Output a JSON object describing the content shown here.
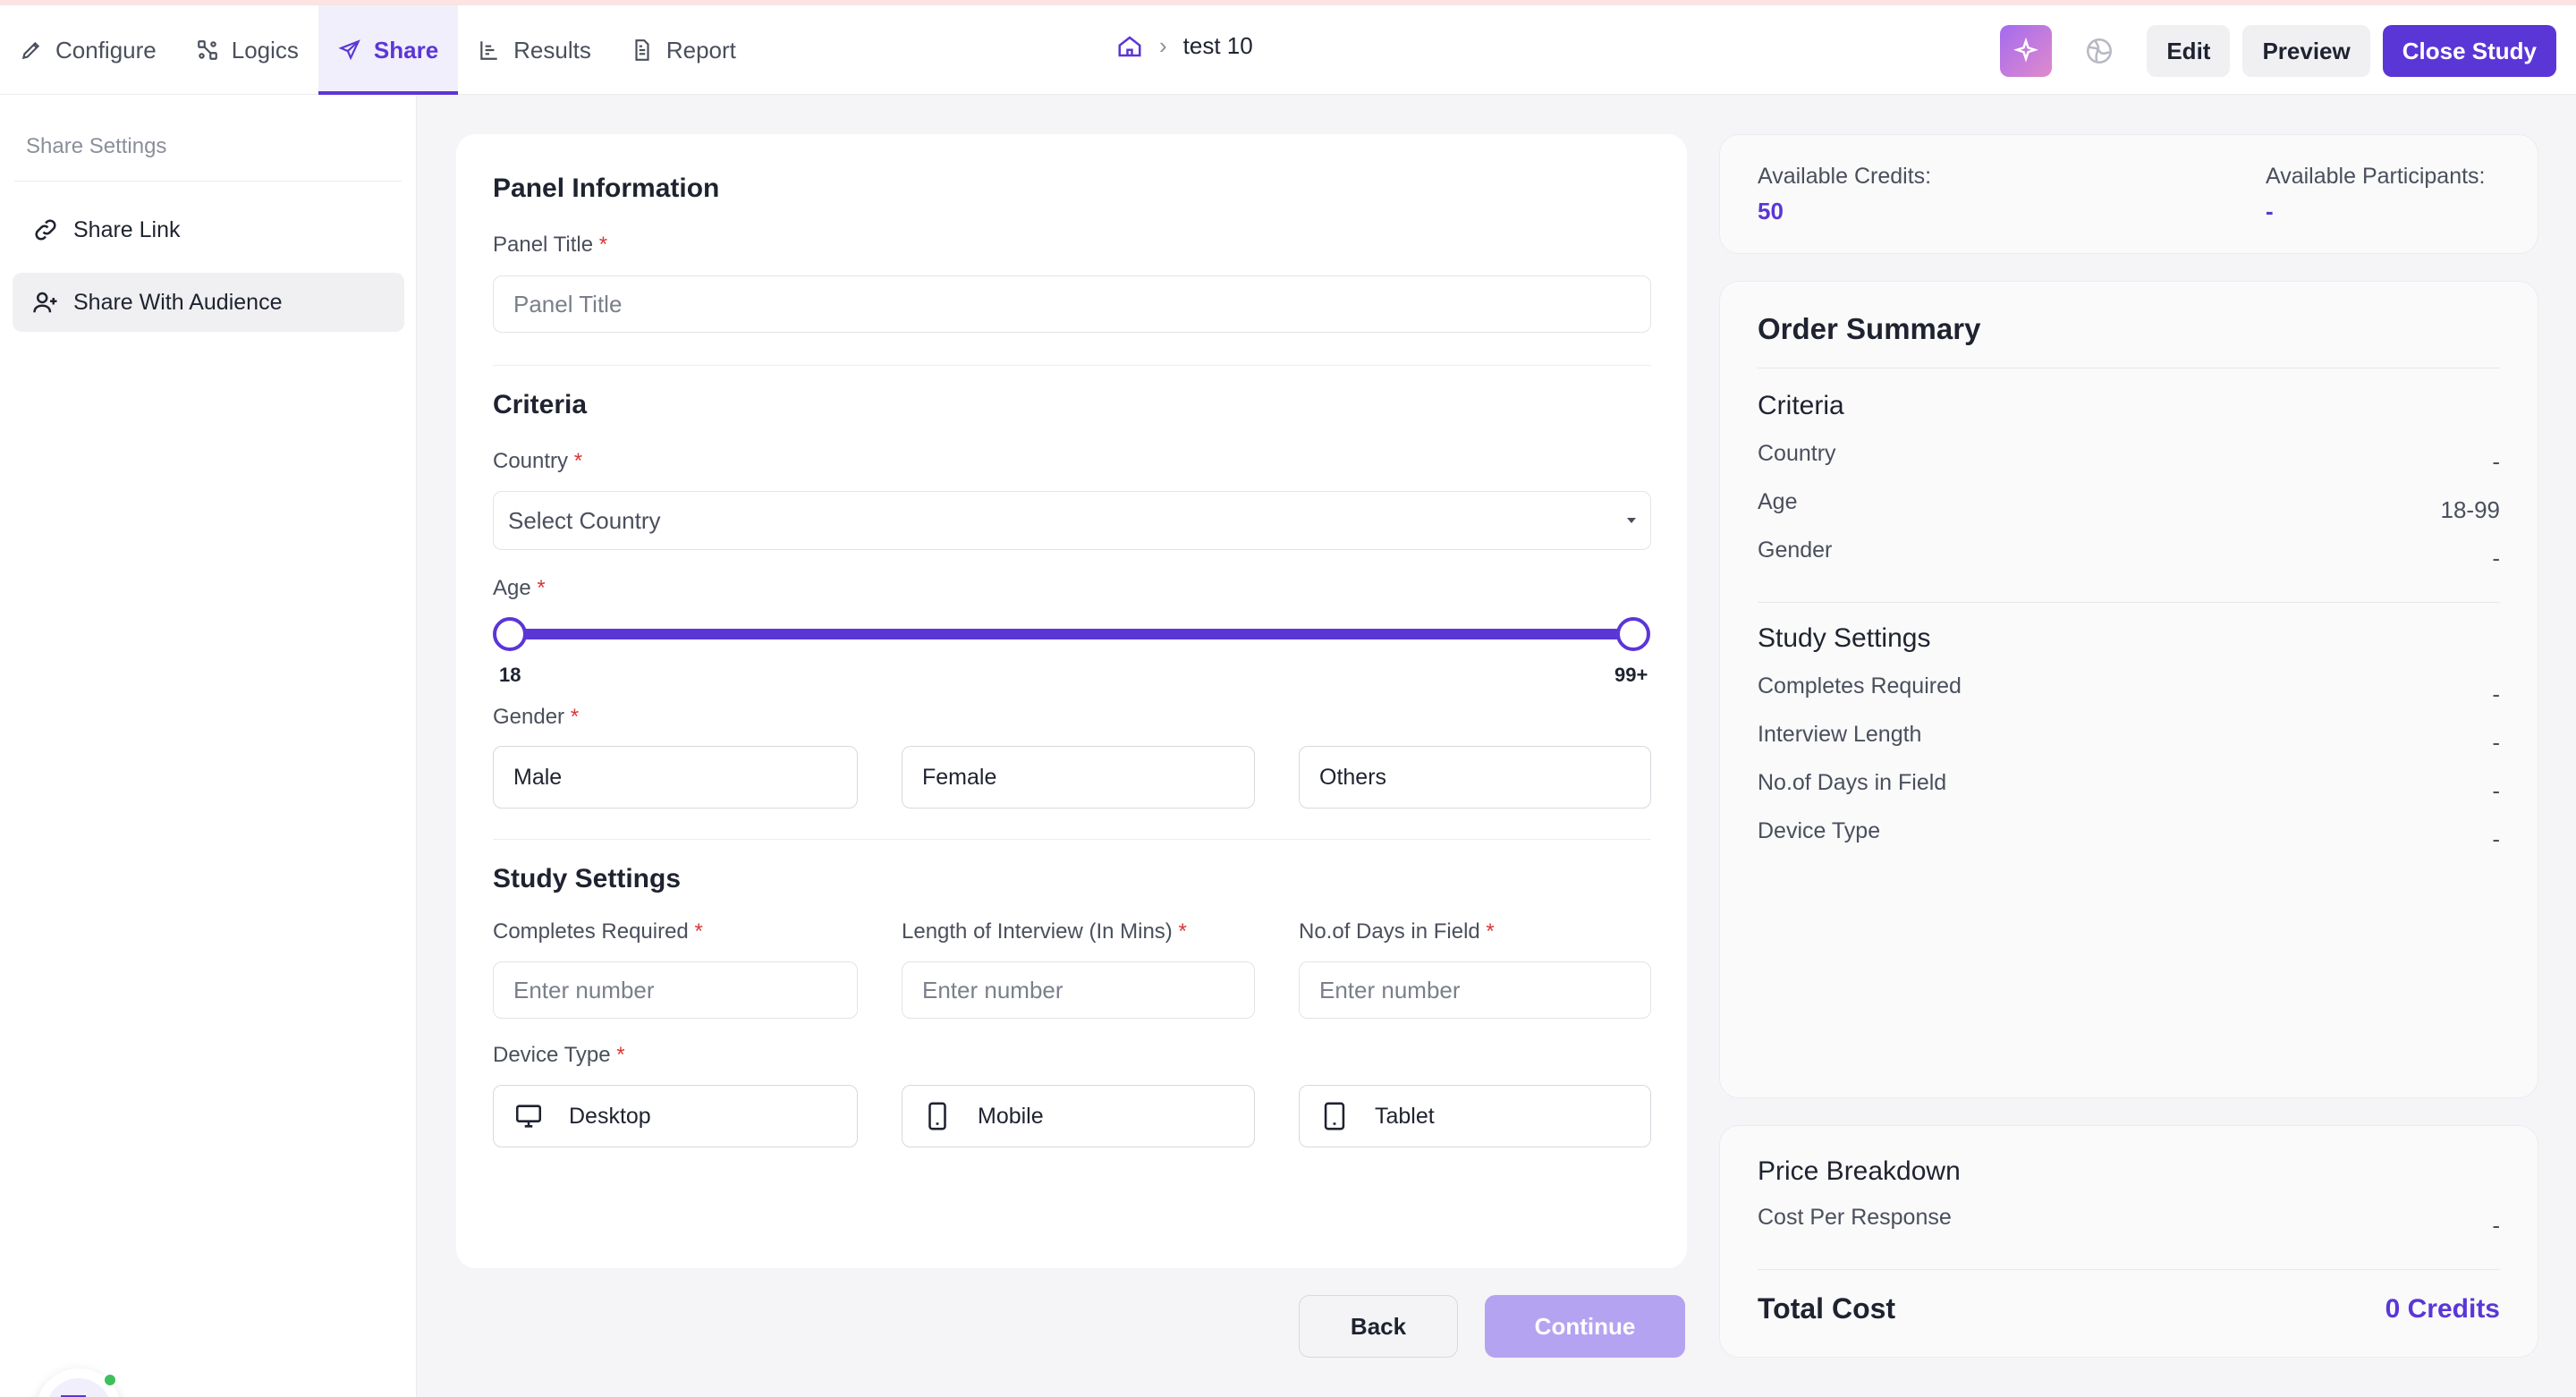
{
  "nav": {
    "tabs": [
      {
        "label": "Configure",
        "icon": "pencil-icon"
      },
      {
        "label": "Logics",
        "icon": "logic-nodes-icon"
      },
      {
        "label": "Share",
        "icon": "send-icon",
        "active": true
      },
      {
        "label": "Results",
        "icon": "chart-icon"
      },
      {
        "label": "Report",
        "icon": "document-icon"
      }
    ],
    "breadcrumb": {
      "home_icon": "home-icon",
      "current": "test 10"
    },
    "actions": {
      "ai_icon": "sparkle-icon",
      "globe_icon": "globe-icon",
      "edit": "Edit",
      "preview": "Preview",
      "close_study": "Close Study"
    }
  },
  "sidebar": {
    "title": "Share Settings",
    "items": [
      {
        "label": "Share Link",
        "icon": "link-icon"
      },
      {
        "label": "Share With Audience",
        "icon": "user-add-icon",
        "active": true
      }
    ],
    "chat_icon": "chat-bubbles-icon"
  },
  "form": {
    "panel": {
      "title": "Panel Information",
      "panel_title_label": "Panel Title",
      "panel_title_placeholder": "Panel Title"
    },
    "criteria": {
      "title": "Criteria",
      "country_label": "Country",
      "country_value": "Select Country",
      "age_label": "Age",
      "age_min": "18",
      "age_max": "99+",
      "gender_label": "Gender",
      "gender_options": [
        "Male",
        "Female",
        "Others"
      ]
    },
    "study_settings": {
      "title": "Study Settings",
      "completes_label": "Completes Required",
      "length_label": "Length of Interview (In Mins)",
      "days_label": "No.of Days in Field",
      "number_placeholder": "Enter number",
      "device_label": "Device Type",
      "devices": [
        {
          "label": "Desktop",
          "icon": "desktop-icon"
        },
        {
          "label": "Mobile",
          "icon": "mobile-icon"
        },
        {
          "label": "Tablet",
          "icon": "tablet-icon"
        }
      ]
    },
    "required_mark": "*",
    "back": "Back",
    "continue": "Continue"
  },
  "credits": {
    "available_credits_label": "Available Credits:",
    "available_credits_value": "50",
    "available_participants_label": "Available Participants:",
    "available_participants_value": "-"
  },
  "order_summary": {
    "title": "Order Summary",
    "criteria_title": "Criteria",
    "criteria_rows": [
      {
        "label": "Country",
        "value": "-"
      },
      {
        "label": "Age",
        "value": "18-99"
      },
      {
        "label": "Gender",
        "value": "-"
      }
    ],
    "settings_title": "Study Settings",
    "settings_rows": [
      {
        "label": "Completes Required",
        "value": "-"
      },
      {
        "label": "Interview Length",
        "value": "-"
      },
      {
        "label": "No.of Days in Field",
        "value": "-"
      },
      {
        "label": "Device Type",
        "value": "-"
      }
    ]
  },
  "price": {
    "title": "Price Breakdown",
    "cost_label": "Cost Per Response",
    "cost_value": "-",
    "total_label": "Total Cost",
    "total_value": "0 Credits"
  },
  "colors": {
    "accent": "#5b36d6",
    "required": "#d93636",
    "continue_disabled": "#b4a3f1",
    "online": "#3fbf5b"
  }
}
